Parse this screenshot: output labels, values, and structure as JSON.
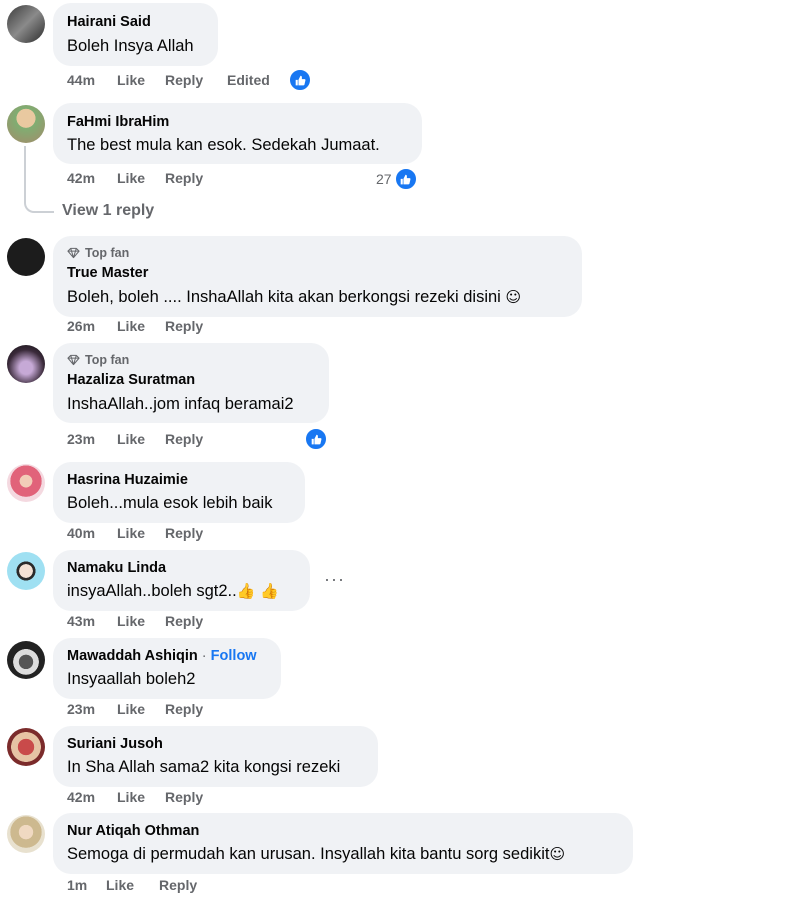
{
  "comments": [
    {
      "name": "Hairani Said",
      "text": "Boleh Insya Allah",
      "time": "44m",
      "like": "Like",
      "reply": "Reply",
      "edited": "Edited"
    },
    {
      "name": "FaHmi IbraHim",
      "text": "The best mula kan esok. Sedekah Jumaat.",
      "time": "42m",
      "like": "Like",
      "reply": "Reply",
      "reactions": "27",
      "view_replies": "View 1 reply"
    },
    {
      "badge": "Top fan",
      "name": "True Master",
      "text": "Boleh, boleh .... InshaAllah kita akan berkongsi rezeki disini",
      "emoji": "☺",
      "time": "26m",
      "like": "Like",
      "reply": "Reply"
    },
    {
      "badge": "Top fan",
      "name": "Hazaliza Suratman",
      "text": "InshaAllah..jom infaq beramai2",
      "time": "23m",
      "like": "Like",
      "reply": "Reply"
    },
    {
      "name": "Hasrina Huzaimie",
      "text": "Boleh...mula esok lebih baik",
      "time": "40m",
      "like": "Like",
      "reply": "Reply"
    },
    {
      "name": "Namaku Linda",
      "text": "insyaAllah..boleh sgt2..",
      "emoji": "👍 👍",
      "time": "43m",
      "like": "Like",
      "reply": "Reply",
      "more": "···"
    },
    {
      "name": "Mawaddah Ashiqin",
      "follow": "Follow",
      "sep": " · ",
      "text": "Insyaallah boleh2",
      "time": "23m",
      "like": "Like",
      "reply": "Reply"
    },
    {
      "name": "Suriani Jusoh",
      "text": "In Sha Allah sama2 kita kongsi rezeki",
      "time": "42m",
      "like": "Like",
      "reply": "Reply"
    },
    {
      "name": "Nur Atiqah Othman",
      "text": "Semoga di permudah kan urusan. Insyallah kita bantu sorg sedikit",
      "emoji": "☺",
      "time": "1m",
      "like": "Like",
      "reply": "Reply"
    }
  ],
  "colors": {
    "accent": "#1877f2",
    "bubble": "#f0f2f5",
    "meta": "#65676b"
  },
  "icons": {
    "reaction": "like-thumb-icon",
    "badge": "diamond-icon",
    "more": "more-dots-icon"
  }
}
